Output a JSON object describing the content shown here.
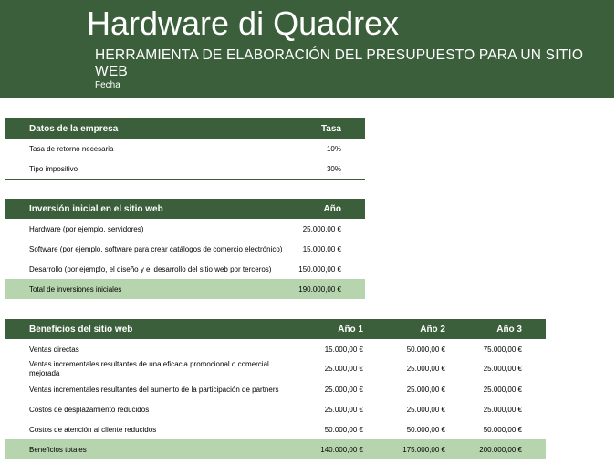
{
  "header": {
    "title": "Hardware di Quadrex",
    "subtitle": "HERRAMIENTA DE ELABORACIÓN DEL PRESUPUESTO PARA UN SITIO WEB",
    "date_label": "Fecha"
  },
  "company": {
    "col_label": "Datos de la empresa",
    "col_rate": "Tasa",
    "rows": [
      {
        "label": "Tasa de retorno necesaria",
        "value": "10%"
      },
      {
        "label": "Tipo impositivo",
        "value": "30%"
      }
    ]
  },
  "investment": {
    "col_label": "Inversión inicial en el sitio web",
    "col_year": "Año",
    "rows": [
      {
        "label": "Hardware (por ejemplo, servidores)",
        "value": "25.000,00 €"
      },
      {
        "label": "Software (por ejemplo, software para crear catálogos de comercio electrónico)",
        "value": "15.000,00 €"
      },
      {
        "label": "Desarrollo (por ejemplo, el diseño y el desarrollo del sitio web por terceros)",
        "value": "150.000,00 €"
      }
    ],
    "total": {
      "label": "Total de inversiones iniciales",
      "value": "190.000,00 €"
    }
  },
  "benefits": {
    "col_label": "Beneficios del sitio web",
    "col_years": [
      "Año 1",
      "Año 2",
      "Año 3"
    ],
    "rows": [
      {
        "label": "Ventas directas",
        "values": [
          "15.000,00 €",
          "50.000,00 €",
          "75.000,00 €"
        ]
      },
      {
        "label": "Ventas incrementales resultantes de una eficacia promocional o comercial mejorada",
        "values": [
          "25.000,00 €",
          "25.000,00 €",
          "25.000,00 €"
        ]
      },
      {
        "label": "Ventas incrementales resultantes del aumento de la participación de partners",
        "values": [
          "25.000,00 €",
          "25.000,00 €",
          "25.000,00 €"
        ]
      },
      {
        "label": "Costos de desplazamiento reducidos",
        "values": [
          "25.000,00 €",
          "25.000,00 €",
          "25.000,00 €"
        ]
      },
      {
        "label": "Costos de atención al cliente reducidos",
        "values": [
          "50.000,00 €",
          "50.000,00 €",
          "50.000,00 €"
        ]
      }
    ],
    "total": {
      "label": "Beneficios totales",
      "values": [
        "140.000,00 €",
        "175.000,00 €",
        "200.000,00 €"
      ]
    }
  },
  "colors": {
    "header_green": "#3b5e3b",
    "total_green": "#b6d4ad"
  }
}
